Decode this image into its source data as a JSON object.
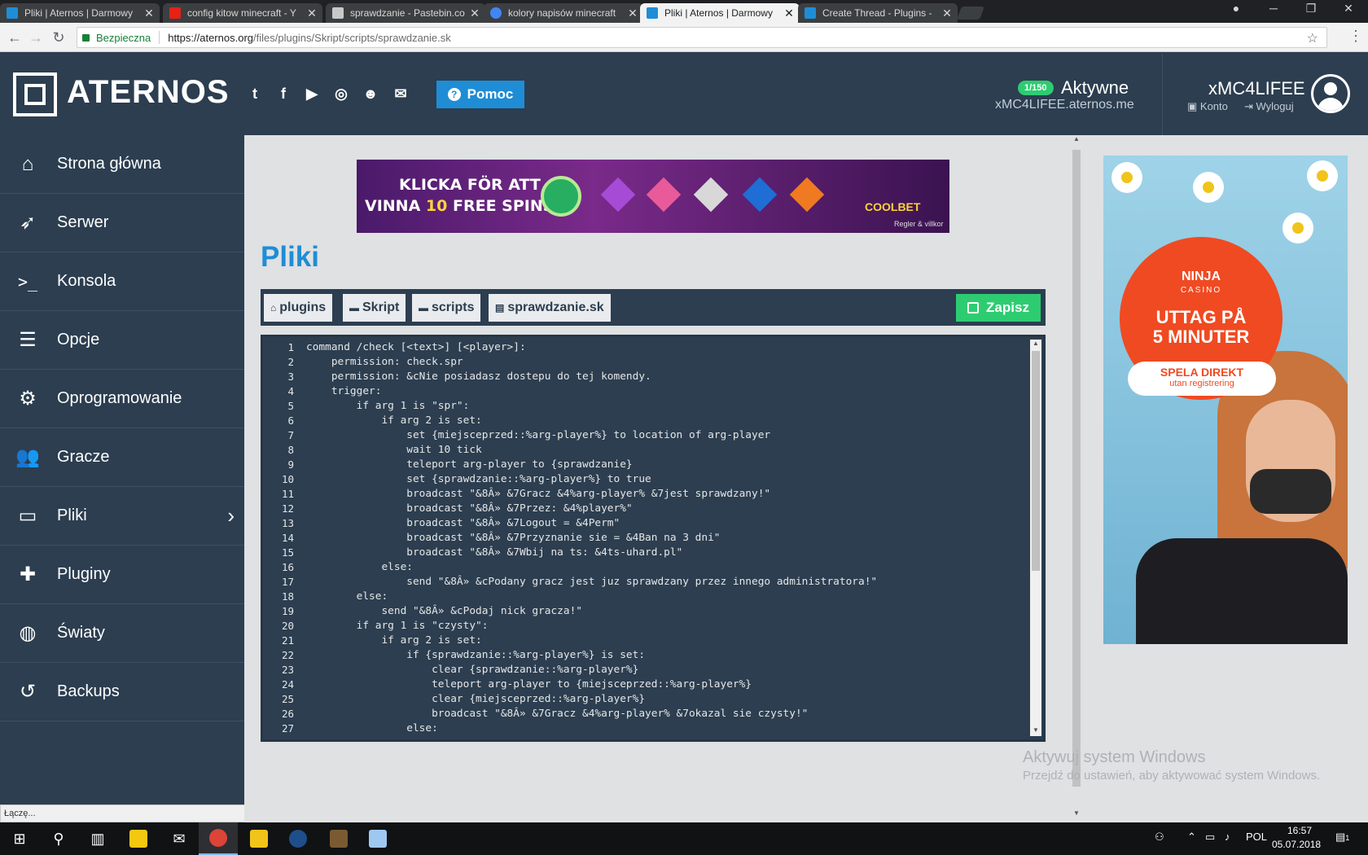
{
  "browser": {
    "tabs": [
      {
        "title": "Pliki | Aternos | Darmowy",
        "active": false,
        "favicon_color": "#1f8dd6"
      },
      {
        "title": "config kitow minecraft - Y",
        "active": false,
        "favicon_color": "#e62117"
      },
      {
        "title": "sprawdzanie - Pastebin.co",
        "active": false,
        "favicon_color": "#c8c8c8"
      },
      {
        "title": "kolory napisów minecraft",
        "active": false,
        "favicon_color": "#4285f4"
      },
      {
        "title": "Pliki | Aternos | Darmowy",
        "active": true,
        "favicon_color": "#1f8dd6"
      },
      {
        "title": "Create Thread - Plugins -",
        "active": false,
        "favicon_color": "#1f8dd6"
      }
    ],
    "secure_label": "Bezpieczna",
    "url_scheme_domain": "https://aternos.org",
    "url_path": "/files/plugins/Skript/scripts/sprawdzanie.sk"
  },
  "header": {
    "logo_text": "ATERNOS",
    "help_label": "Pomoc",
    "status_badge": "1/150",
    "status_text": "Aktywne",
    "server_address": "xMC4LIFEE.aternos.me",
    "username": "xMC4LIFEE",
    "account_label": "Konto",
    "logout_label": "Wyloguj"
  },
  "sidebar": {
    "items": [
      {
        "label": "Strona główna",
        "icon": "home-icon"
      },
      {
        "label": "Serwer",
        "icon": "rocket-icon"
      },
      {
        "label": "Konsola",
        "icon": "terminal-icon"
      },
      {
        "label": "Opcje",
        "icon": "sliders-icon"
      },
      {
        "label": "Oprogramowanie",
        "icon": "cogs-icon"
      },
      {
        "label": "Gracze",
        "icon": "users-icon"
      },
      {
        "label": "Pliki",
        "icon": "folder-icon"
      },
      {
        "label": "Pluginy",
        "icon": "puzzle-icon"
      },
      {
        "label": "Światy",
        "icon": "globe-icon"
      },
      {
        "label": "Backups",
        "icon": "undo-icon"
      }
    ],
    "status_text": "Łączę..."
  },
  "main": {
    "page_title": "Pliki",
    "breadcrumbs": [
      "plugins",
      "Skript",
      "scripts",
      "sprawdzanie.sk"
    ],
    "save_label": "Zapisz",
    "line_numbers": [
      "1",
      "2",
      "3",
      "4",
      "5",
      "6",
      "7",
      "8",
      "9",
      "10",
      "11",
      "12",
      "13",
      "14",
      "15",
      "16",
      "17",
      "18",
      "19",
      "20",
      "21",
      "22",
      "23",
      "24",
      "25",
      "26",
      "27"
    ],
    "code_lines": [
      "command /check [<text>] [<player>]:",
      "    permission: check.spr",
      "    permission: &cNie posiadasz dostepu do tej komendy.",
      "    trigger:",
      "        if arg 1 is \"spr\":",
      "            if arg 2 is set:",
      "                set {miejsceprzed::%arg-player%} to location of arg-player",
      "                wait 10 tick",
      "                teleport arg-player to {sprawdzanie}",
      "                set {sprawdzanie::%arg-player%} to true",
      "                broadcast \"&8Â» &7Gracz &4%arg-player% &7jest sprawdzany!\"",
      "                broadcast \"&8Â» &7Przez: &4%player%\"",
      "                broadcast \"&8Â» &7Logout = &4Perm\"",
      "                broadcast \"&8Â» &7Przyznanie sie = &4Ban na 3 dni\"",
      "                broadcast \"&8Â» &7Wbij na ts: &4ts-uhard.pl\"",
      "            else:",
      "                send \"&8Â» &cPodany gracz jest juz sprawdzany przez innego administratora!\"",
      "        else:",
      "            send \"&8Â» &cPodaj nick gracza!\"",
      "        if arg 1 is \"czysty\":",
      "            if arg 2 is set:",
      "                if {sprawdzanie::%arg-player%} is set:",
      "                    clear {sprawdzanie::%arg-player%}",
      "                    teleport arg-player to {miejsceprzed::%arg-player%}",
      "                    clear {miejsceprzed::%arg-player%}",
      "                    broadcast \"&8Â» &7Gracz &4%arg-player% &7okazal sie czysty!\"",
      "                else:"
    ]
  },
  "ads": {
    "banner_line1": "KLICKA FÖR ATT",
    "banner_line2_pre": "VINNA",
    "banner_line2_num": "10",
    "banner_line2_post": "FREE SPINS",
    "banner_brand": "COOLBET",
    "banner_terms": "Regler & villkor",
    "side_brand": "NINJA",
    "side_brand_sub": "CASINO",
    "side_headline1": "UTTAG PÅ",
    "side_headline2": "5 MINUTER",
    "side_cta1": "SPELA DIREKT",
    "side_cta2": "utan registrering"
  },
  "windows": {
    "watermark_title": "Aktywuj system Windows",
    "watermark_sub": "Przejdź do ustawień, aby aktywować system Windows.",
    "language": "POL",
    "time": "16:57",
    "date": "05.07.2018",
    "notifications": "1"
  },
  "colors": {
    "brand_dark": "#2c3e50",
    "accent_blue": "#1f8dd6",
    "success_green": "#2ecc71"
  }
}
